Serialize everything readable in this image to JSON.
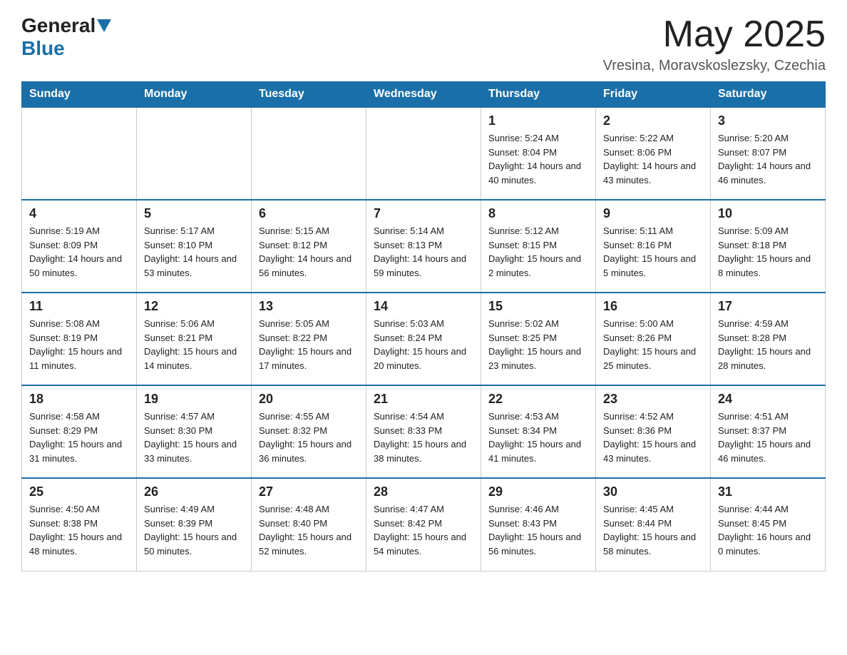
{
  "header": {
    "logo_general": "General",
    "logo_blue": "Blue",
    "month_title": "May 2025",
    "location": "Vresina, Moravskoslezsky, Czechia"
  },
  "weekdays": [
    "Sunday",
    "Monday",
    "Tuesday",
    "Wednesday",
    "Thursday",
    "Friday",
    "Saturday"
  ],
  "weeks": [
    [
      {
        "day": "",
        "sunrise": "",
        "sunset": "",
        "daylight": ""
      },
      {
        "day": "",
        "sunrise": "",
        "sunset": "",
        "daylight": ""
      },
      {
        "day": "",
        "sunrise": "",
        "sunset": "",
        "daylight": ""
      },
      {
        "day": "",
        "sunrise": "",
        "sunset": "",
        "daylight": ""
      },
      {
        "day": "1",
        "sunrise": "Sunrise: 5:24 AM",
        "sunset": "Sunset: 8:04 PM",
        "daylight": "Daylight: 14 hours and 40 minutes."
      },
      {
        "day": "2",
        "sunrise": "Sunrise: 5:22 AM",
        "sunset": "Sunset: 8:06 PM",
        "daylight": "Daylight: 14 hours and 43 minutes."
      },
      {
        "day": "3",
        "sunrise": "Sunrise: 5:20 AM",
        "sunset": "Sunset: 8:07 PM",
        "daylight": "Daylight: 14 hours and 46 minutes."
      }
    ],
    [
      {
        "day": "4",
        "sunrise": "Sunrise: 5:19 AM",
        "sunset": "Sunset: 8:09 PM",
        "daylight": "Daylight: 14 hours and 50 minutes."
      },
      {
        "day": "5",
        "sunrise": "Sunrise: 5:17 AM",
        "sunset": "Sunset: 8:10 PM",
        "daylight": "Daylight: 14 hours and 53 minutes."
      },
      {
        "day": "6",
        "sunrise": "Sunrise: 5:15 AM",
        "sunset": "Sunset: 8:12 PM",
        "daylight": "Daylight: 14 hours and 56 minutes."
      },
      {
        "day": "7",
        "sunrise": "Sunrise: 5:14 AM",
        "sunset": "Sunset: 8:13 PM",
        "daylight": "Daylight: 14 hours and 59 minutes."
      },
      {
        "day": "8",
        "sunrise": "Sunrise: 5:12 AM",
        "sunset": "Sunset: 8:15 PM",
        "daylight": "Daylight: 15 hours and 2 minutes."
      },
      {
        "day": "9",
        "sunrise": "Sunrise: 5:11 AM",
        "sunset": "Sunset: 8:16 PM",
        "daylight": "Daylight: 15 hours and 5 minutes."
      },
      {
        "day": "10",
        "sunrise": "Sunrise: 5:09 AM",
        "sunset": "Sunset: 8:18 PM",
        "daylight": "Daylight: 15 hours and 8 minutes."
      }
    ],
    [
      {
        "day": "11",
        "sunrise": "Sunrise: 5:08 AM",
        "sunset": "Sunset: 8:19 PM",
        "daylight": "Daylight: 15 hours and 11 minutes."
      },
      {
        "day": "12",
        "sunrise": "Sunrise: 5:06 AM",
        "sunset": "Sunset: 8:21 PM",
        "daylight": "Daylight: 15 hours and 14 minutes."
      },
      {
        "day": "13",
        "sunrise": "Sunrise: 5:05 AM",
        "sunset": "Sunset: 8:22 PM",
        "daylight": "Daylight: 15 hours and 17 minutes."
      },
      {
        "day": "14",
        "sunrise": "Sunrise: 5:03 AM",
        "sunset": "Sunset: 8:24 PM",
        "daylight": "Daylight: 15 hours and 20 minutes."
      },
      {
        "day": "15",
        "sunrise": "Sunrise: 5:02 AM",
        "sunset": "Sunset: 8:25 PM",
        "daylight": "Daylight: 15 hours and 23 minutes."
      },
      {
        "day": "16",
        "sunrise": "Sunrise: 5:00 AM",
        "sunset": "Sunset: 8:26 PM",
        "daylight": "Daylight: 15 hours and 25 minutes."
      },
      {
        "day": "17",
        "sunrise": "Sunrise: 4:59 AM",
        "sunset": "Sunset: 8:28 PM",
        "daylight": "Daylight: 15 hours and 28 minutes."
      }
    ],
    [
      {
        "day": "18",
        "sunrise": "Sunrise: 4:58 AM",
        "sunset": "Sunset: 8:29 PM",
        "daylight": "Daylight: 15 hours and 31 minutes."
      },
      {
        "day": "19",
        "sunrise": "Sunrise: 4:57 AM",
        "sunset": "Sunset: 8:30 PM",
        "daylight": "Daylight: 15 hours and 33 minutes."
      },
      {
        "day": "20",
        "sunrise": "Sunrise: 4:55 AM",
        "sunset": "Sunset: 8:32 PM",
        "daylight": "Daylight: 15 hours and 36 minutes."
      },
      {
        "day": "21",
        "sunrise": "Sunrise: 4:54 AM",
        "sunset": "Sunset: 8:33 PM",
        "daylight": "Daylight: 15 hours and 38 minutes."
      },
      {
        "day": "22",
        "sunrise": "Sunrise: 4:53 AM",
        "sunset": "Sunset: 8:34 PM",
        "daylight": "Daylight: 15 hours and 41 minutes."
      },
      {
        "day": "23",
        "sunrise": "Sunrise: 4:52 AM",
        "sunset": "Sunset: 8:36 PM",
        "daylight": "Daylight: 15 hours and 43 minutes."
      },
      {
        "day": "24",
        "sunrise": "Sunrise: 4:51 AM",
        "sunset": "Sunset: 8:37 PM",
        "daylight": "Daylight: 15 hours and 46 minutes."
      }
    ],
    [
      {
        "day": "25",
        "sunrise": "Sunrise: 4:50 AM",
        "sunset": "Sunset: 8:38 PM",
        "daylight": "Daylight: 15 hours and 48 minutes."
      },
      {
        "day": "26",
        "sunrise": "Sunrise: 4:49 AM",
        "sunset": "Sunset: 8:39 PM",
        "daylight": "Daylight: 15 hours and 50 minutes."
      },
      {
        "day": "27",
        "sunrise": "Sunrise: 4:48 AM",
        "sunset": "Sunset: 8:40 PM",
        "daylight": "Daylight: 15 hours and 52 minutes."
      },
      {
        "day": "28",
        "sunrise": "Sunrise: 4:47 AM",
        "sunset": "Sunset: 8:42 PM",
        "daylight": "Daylight: 15 hours and 54 minutes."
      },
      {
        "day": "29",
        "sunrise": "Sunrise: 4:46 AM",
        "sunset": "Sunset: 8:43 PM",
        "daylight": "Daylight: 15 hours and 56 minutes."
      },
      {
        "day": "30",
        "sunrise": "Sunrise: 4:45 AM",
        "sunset": "Sunset: 8:44 PM",
        "daylight": "Daylight: 15 hours and 58 minutes."
      },
      {
        "day": "31",
        "sunrise": "Sunrise: 4:44 AM",
        "sunset": "Sunset: 8:45 PM",
        "daylight": "Daylight: 16 hours and 0 minutes."
      }
    ]
  ]
}
